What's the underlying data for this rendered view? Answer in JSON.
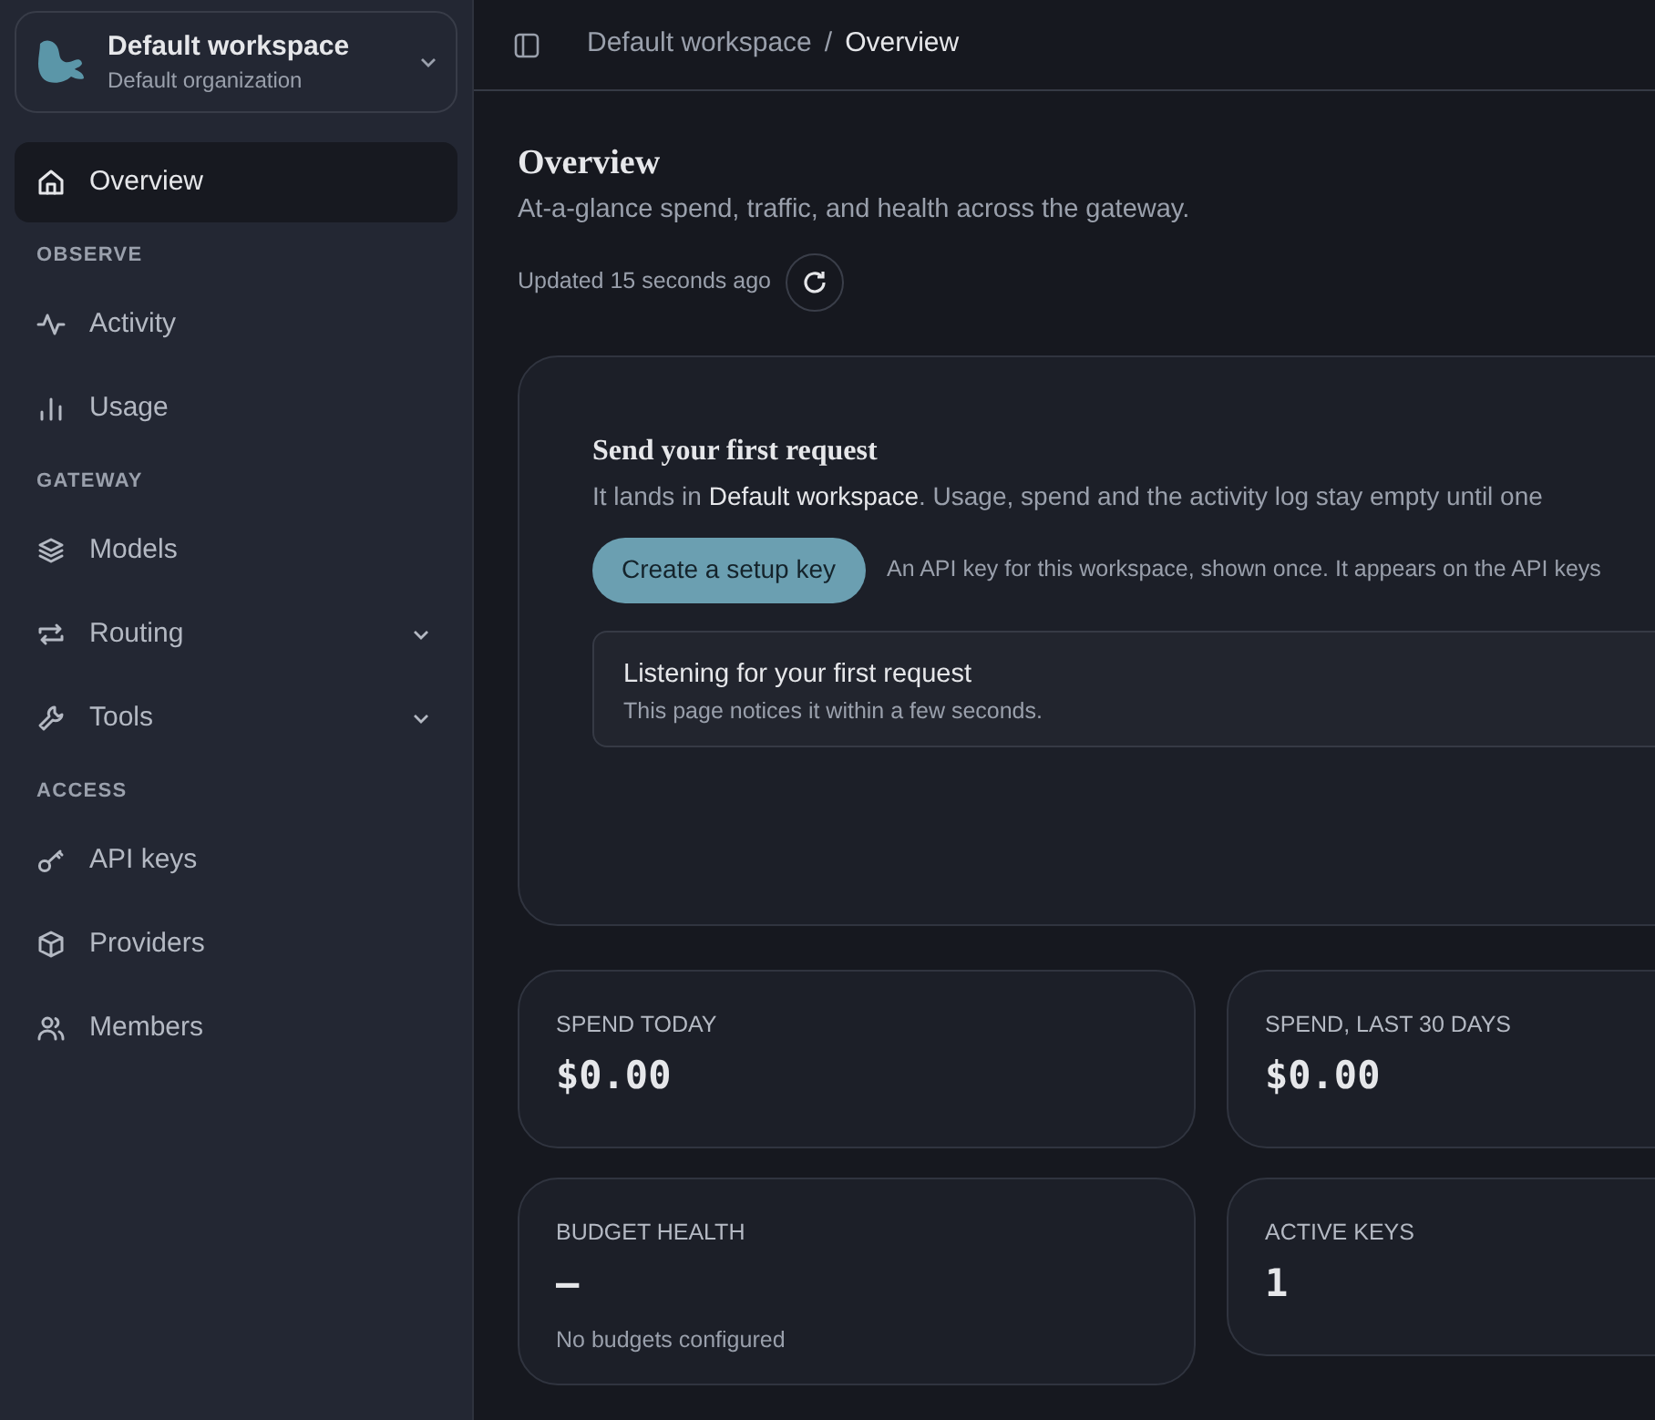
{
  "workspace": {
    "name": "Default workspace",
    "organization": "Default organization"
  },
  "sidebar": {
    "items": [
      {
        "kind": "link",
        "label": "Overview",
        "selected": true
      },
      {
        "kind": "header",
        "label": "OBSERVE"
      },
      {
        "kind": "link",
        "label": "Activity",
        "selected": false
      },
      {
        "kind": "link",
        "label": "Usage",
        "selected": false
      },
      {
        "kind": "header",
        "label": "GATEWAY"
      },
      {
        "kind": "link",
        "label": "Models",
        "selected": false
      },
      {
        "kind": "group",
        "label": "Routing",
        "selected": false,
        "expanded": false
      },
      {
        "kind": "group",
        "label": "Tools",
        "selected": false,
        "expanded": false
      },
      {
        "kind": "header",
        "label": "ACCESS"
      },
      {
        "kind": "link",
        "label": "API keys",
        "selected": false
      },
      {
        "kind": "link",
        "label": "Providers",
        "selected": false
      },
      {
        "kind": "link",
        "label": "Members",
        "selected": false
      }
    ]
  },
  "breadcrumb": [
    "Default workspace",
    "Overview"
  ],
  "breadcrumb_separator": "/",
  "page": {
    "title": "Overview",
    "subtitle": "At-a-glance spend, traffic, and health across the gateway.",
    "updated": "Updated 15 seconds ago"
  },
  "onboarding": {
    "title": "Send your first request",
    "text": "It lands in **Default workspace**. Usage, spend and the activity log stay empty until one",
    "button": "Create a setup key",
    "hint": "An API key for this workspace, shown once. It appears on the API keys",
    "listening_title": "Listening for your first request",
    "listening_text": "This page notices it within a few seconds."
  },
  "stats": [
    {
      "label": "SPEND TODAY",
      "value": "$0.00"
    },
    {
      "label": "SPEND, LAST 30 DAYS",
      "value": "$0.00"
    },
    {
      "label": "BUDGET HEALTH",
      "value": "—",
      "note": "No budgets configured"
    },
    {
      "label": "ACTIVE KEYS",
      "value": "1"
    }
  ]
}
